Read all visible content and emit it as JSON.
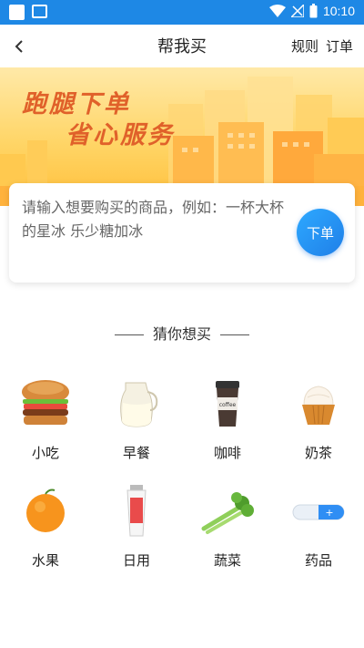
{
  "status_bar": {
    "time": "10:10"
  },
  "app_bar": {
    "title": "帮我买",
    "rules_label": "规则",
    "orders_label": "订单"
  },
  "banner": {
    "line1": "跑腿下单",
    "line2": "省心服务"
  },
  "order_card": {
    "placeholder": "请输入想要购买的商品，例如：一杯大杯的星冰 乐少糖加冰",
    "submit_label": "下单"
  },
  "guess": {
    "title": "猜你想买",
    "items": [
      {
        "label": "小吃",
        "icon": "burger-icon"
      },
      {
        "label": "早餐",
        "icon": "milk-jug-icon"
      },
      {
        "label": "咖啡",
        "icon": "coffee-cup-icon"
      },
      {
        "label": "奶茶",
        "icon": "cupcake-icon"
      },
      {
        "label": "水果",
        "icon": "orange-icon"
      },
      {
        "label": "日用",
        "icon": "toothpaste-icon"
      },
      {
        "label": "蔬菜",
        "icon": "celery-icon"
      },
      {
        "label": "药品",
        "icon": "capsule-icon"
      }
    ]
  },
  "colors": {
    "status_bar": "#1e88e5",
    "accent": "#2196f3",
    "banner_text": "#e0612a"
  }
}
